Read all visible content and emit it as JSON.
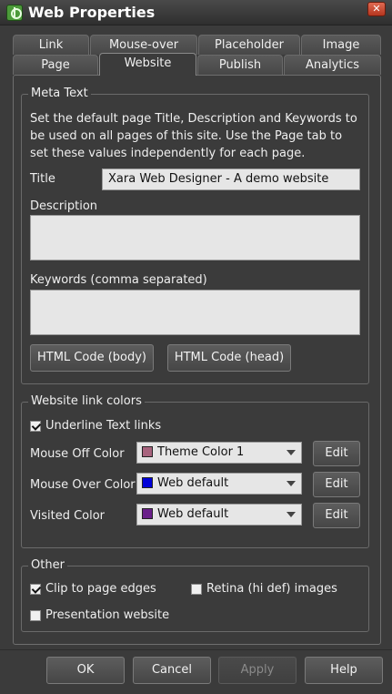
{
  "window": {
    "title": "Web Properties",
    "close_glyph": "✕"
  },
  "tabs": {
    "row1": [
      "Link",
      "Mouse-over",
      "Placeholder",
      "Image"
    ],
    "row2": [
      "Page",
      "Website",
      "Publish",
      "Analytics"
    ],
    "active": "Website"
  },
  "meta_text": {
    "group_label": "Meta Text",
    "description": "Set the default page Title, Description and Keywords to be used on all pages of this site. Use the Page tab to set these values independently for each page.",
    "title_label": "Title",
    "title_value": "Xara Web Designer - A demo website",
    "description_label": "Description",
    "description_value": "",
    "keywords_label": "Keywords (comma separated)",
    "keywords_value": "",
    "html_body_button": "HTML Code (body)",
    "html_head_button": "HTML Code (head)"
  },
  "link_colors": {
    "group_label": "Website link colors",
    "underline_label": "Underline Text links",
    "underline_checked": true,
    "rows": [
      {
        "label": "Mouse Off Color",
        "value": "Theme Color 1",
        "swatch": "#a8647e",
        "edit": "Edit"
      },
      {
        "label": "Mouse Over Color",
        "value": "Web default",
        "swatch": "#0000d8",
        "edit": "Edit"
      },
      {
        "label": "Visited Color",
        "value": "Web default",
        "swatch": "#6a1f8a",
        "edit": "Edit"
      }
    ]
  },
  "other": {
    "group_label": "Other",
    "clip_label": "Clip to page edges",
    "clip_checked": true,
    "retina_label": "Retina (hi def) images",
    "retina_checked": false,
    "presentation_label": "Presentation website",
    "presentation_checked": false
  },
  "footer": {
    "ok": "OK",
    "cancel": "Cancel",
    "apply": "Apply",
    "help": "Help"
  }
}
